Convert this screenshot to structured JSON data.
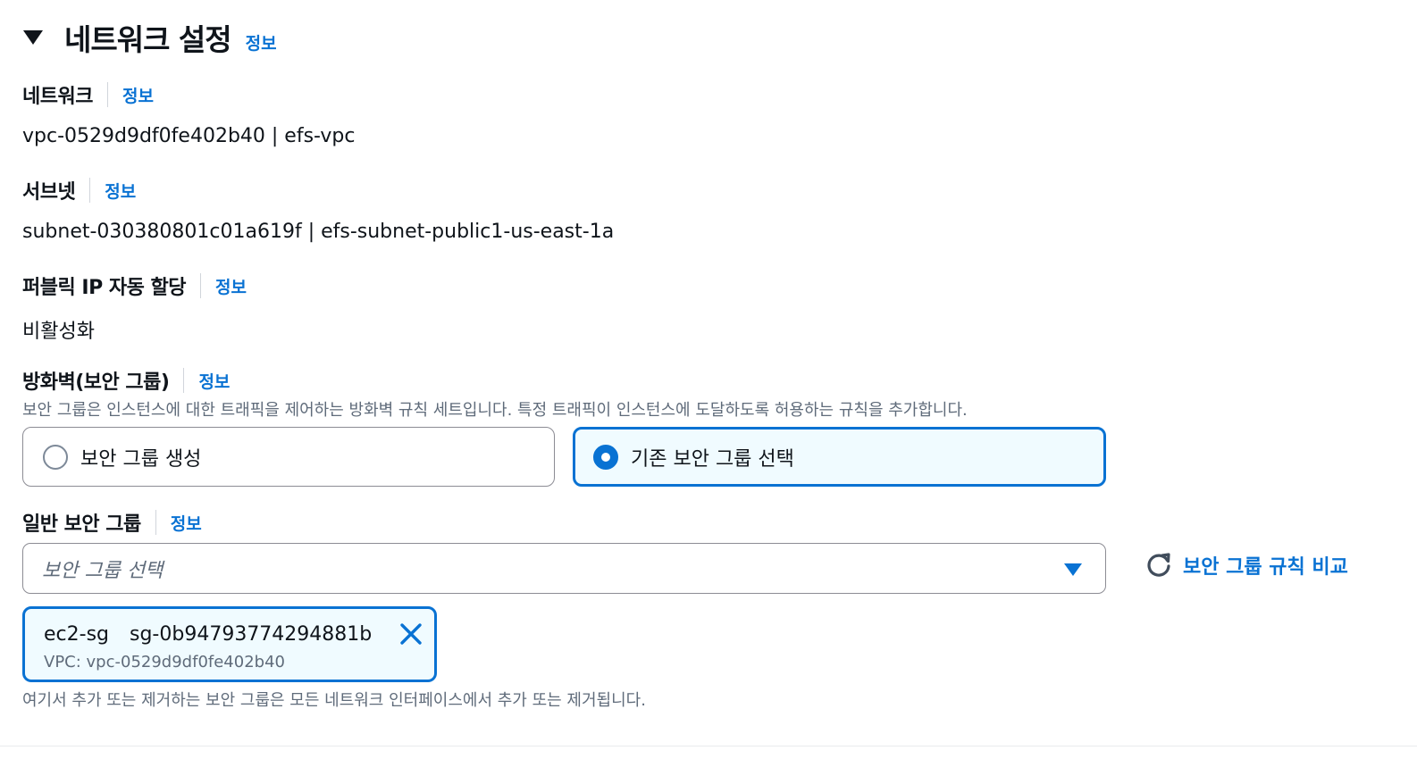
{
  "section": {
    "title": "네트워크 설정",
    "info": "정보"
  },
  "network": {
    "label": "네트워크",
    "info": "정보",
    "value": "vpc-0529d9df0fe402b40 | efs-vpc"
  },
  "subnet": {
    "label": "서브넷",
    "info": "정보",
    "value": "subnet-030380801c01a619f | efs-subnet-public1-us-east-1a"
  },
  "public_ip": {
    "label": "퍼블릭 IP 자동 할당",
    "info": "정보",
    "value": "비활성화"
  },
  "firewall": {
    "label": "방화벽(보안 그룹)",
    "info": "정보",
    "description": "보안 그룹은 인스턴스에 대한 트래픽을 제어하는 방화벽 규칙 세트입니다. 특정 트래픽이 인스턴스에 도달하도록 허용하는 규칙을 추가합니다.",
    "options": [
      {
        "label": "보안 그룹 생성",
        "selected": false
      },
      {
        "label": "기존 보안 그룹 선택",
        "selected": true
      }
    ]
  },
  "common_sg": {
    "label": "일반 보안 그룹",
    "info": "정보",
    "placeholder": "보안 그룹 선택",
    "compare_label": "보안 그룹 규칙 비교",
    "token": {
      "name": "ec2-sg",
      "id": "sg-0b94793774294881b",
      "vpc": "VPC: vpc-0529d9df0fe402b40"
    },
    "note": "여기서 추가 또는 제거하는 보안 그룹은 모든 네트워크 인터페이스에서 추가 또는 제거됩니다."
  },
  "colors": {
    "accent": "#0972d3",
    "text": "#0f141a",
    "muted": "#5f6b7a",
    "border": "#8c8c94",
    "selected_bg": "#f0fbff"
  },
  "icons": {
    "collapse": "caret-down-icon",
    "dropdown": "caret-down-icon",
    "refresh": "refresh-icon",
    "dismiss": "close-icon"
  }
}
